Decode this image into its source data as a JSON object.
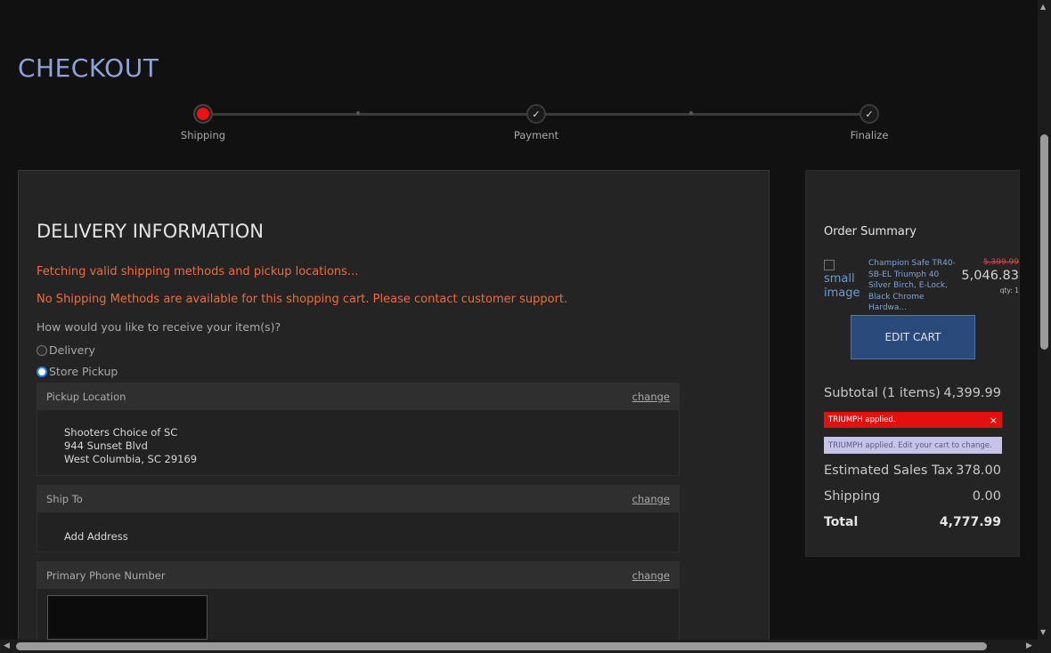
{
  "page": {
    "title": "CHECKOUT"
  },
  "steps": [
    {
      "label": "Shipping",
      "mark": "",
      "active": true
    },
    {
      "label": "Payment",
      "mark": "✓",
      "active": false
    },
    {
      "label": "Finalize",
      "mark": "✓",
      "active": false
    }
  ],
  "delivery": {
    "title": "DELIVERY INFORMATION",
    "fetching_msg": "Fetching valid shipping methods and pickup locations...",
    "no_methods_msg": "No Shipping Methods are available for this shopping cart. Please contact customer support.",
    "question": "How would you like to receive your item(s)?",
    "options": [
      {
        "label": "Delivery",
        "selected": false
      },
      {
        "label": "Store Pickup",
        "selected": true
      }
    ]
  },
  "pickup": {
    "header": "Pickup Location",
    "change_label": "change",
    "name": "Shooters Choice of SC",
    "street": "944 Sunset Blvd",
    "city": "West Columbia, SC 29169"
  },
  "ship_to": {
    "header": "Ship To",
    "change_label": "change",
    "add_label": "Add Address"
  },
  "phone": {
    "header": "Primary Phone Number",
    "change_label": "change",
    "value": ""
  },
  "summary": {
    "title": "Order Summary",
    "image_alt": "small image",
    "product_name": "Champion Safe TR40-SB-EL Triumph 40 Silver Birch, E-Lock, Black Chrome Hardwa...",
    "old_price": "5,399.99",
    "new_price": "5,046.83",
    "qty": "qty: 1",
    "edit_cart_label": "EDIT CART",
    "subtotal_label": "Subtotal (1 items)",
    "subtotal_value": "4,399.99",
    "promo_applied": "TRIUMPH applied.",
    "promo_close": "×",
    "promo_note": "TRIUMPH applied. Edit your cart to change.",
    "tax_label": "Estimated Sales Tax",
    "tax_value": "378.00",
    "shipping_label": "Shipping",
    "shipping_value": "0.00",
    "total_label": "Total",
    "total_value": "4,777.99"
  },
  "colors": {
    "title": "#8ea4d8",
    "warning": "#ec6d3b",
    "active_step": "#e11111",
    "edit_button": "#2a4a7b",
    "promo_red": "#e31010",
    "promo_note_bg": "#c7c2ea"
  }
}
